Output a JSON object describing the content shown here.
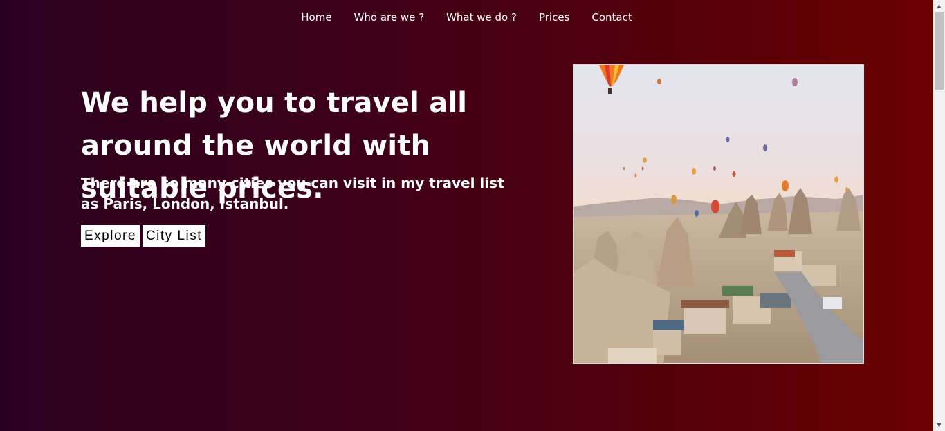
{
  "nav": {
    "items": [
      {
        "label": "Home"
      },
      {
        "label": "Who are we ?"
      },
      {
        "label": "What we do ?"
      },
      {
        "label": "Prices"
      },
      {
        "label": "Contact"
      }
    ]
  },
  "hero": {
    "headline": "We help you to travel all around the world with suitable prices.",
    "subline": "There are so many cities you can visit in my travel list as Paris, London, Istanbul.",
    "explore_label": "Explore",
    "city_list_label": "City List"
  },
  "colors": {
    "gradient_start": "#2a001f",
    "gradient_end": "#6b0000",
    "button_bg": "#ffffff"
  },
  "scrollbar": {
    "up_arrow": "▲",
    "down_arrow": "▼"
  }
}
